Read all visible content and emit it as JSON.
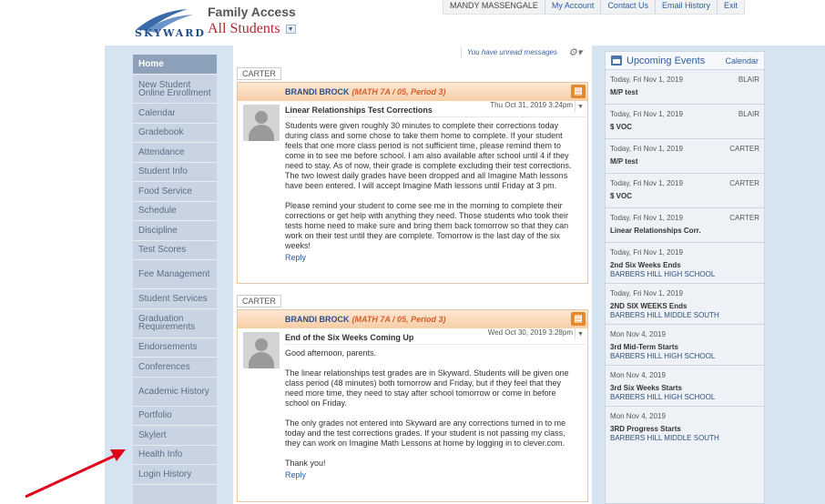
{
  "header": {
    "logo_text": "SKYWARD",
    "app_title": "Family Access",
    "student_selector": "All Students",
    "top_links": [
      "MANDY MASSENGALE",
      "My Account",
      "Contact Us",
      "Email History",
      "Exit"
    ]
  },
  "sidebar": {
    "items": [
      {
        "label": "Home",
        "active": true
      },
      {
        "label": "New Student Online Enrollment"
      },
      {
        "label": "Calendar"
      },
      {
        "label": "Gradebook"
      },
      {
        "label": "Attendance"
      },
      {
        "label": "Student Info"
      },
      {
        "label": "Food Service"
      },
      {
        "label": "Schedule"
      },
      {
        "label": "Discipline"
      },
      {
        "label": "Test Scores"
      },
      {
        "label": "Fee Management"
      },
      {
        "label": "Student Services"
      },
      {
        "label": "Graduation Requirements"
      },
      {
        "label": "Endorsements"
      },
      {
        "label": "Conferences"
      },
      {
        "label": "Academic History"
      },
      {
        "label": "Portfolio"
      },
      {
        "label": "Skylert"
      },
      {
        "label": "Health Info"
      },
      {
        "label": "Login History"
      }
    ]
  },
  "messages": {
    "unread_notice": "You have unread messages",
    "items": [
      {
        "student": "CARTER",
        "sender": "BRANDI BROCK",
        "class_info": "(MATH 7A / 05, Period 3)",
        "subject": "Linear Relationships Test Corrections",
        "timestamp": "Thu Oct 31, 2019 3:24pm",
        "paragraphs": [
          "Students were given roughly 30 minutes to complete their corrections today during class and some chose to take them home to complete.  If your student feels that one more class period is not sufficient time, please remind them to come in to see me before school.  I am also available after school until 4 if they need to stay.  As of now, their grade is complete excluding their test corrections.  The two lowest daily grades have been dropped and all Imagine Math lessons have been entered.  I will accept Imagine Math lessons until Friday at 3 pm.",
          "Please remind your student to come see me in the morning to complete their corrections or get help with anything they need.  Those students who took their tests home need to make sure and bring them back tomorrow so that they can work on their test until they are complete.  Tomorrow is the last day of the six weeks!"
        ],
        "reply_label": "Reply"
      },
      {
        "student": "CARTER",
        "sender": "BRANDI BROCK",
        "class_info": "(MATH 7A / 05, Period 3)",
        "subject": "End of the Six Weeks Coming Up",
        "timestamp": "Wed Oct 30, 2019 3:28pm",
        "paragraphs": [
          "Good afternoon, parents.",
          "The linear relationships test grades are in Skyward.  Students will be given one class period (48 minutes) both tomorrow and Friday, but if they feel that they need more time, they need to stay after school tomorrow or come in before school on Friday.",
          "The only grades not entered into Skyward are any corrections turned in to me today and the test corrections grades.  If your student is not passing my class, they can work on Imagine Math Lessons at home by logging in to clever.com.",
          "Thank you!"
        ],
        "reply_label": "Reply"
      }
    ]
  },
  "events": {
    "title": "Upcoming Events",
    "calendar_link": "Calendar",
    "items": [
      {
        "date": "Today, Fri Nov 1, 2019",
        "student": "BLAIR",
        "title": "M/P test",
        "school": ""
      },
      {
        "date": "Today, Fri Nov 1, 2019",
        "student": "BLAIR",
        "title": "$ VOC",
        "school": ""
      },
      {
        "date": "Today, Fri Nov 1, 2019",
        "student": "CARTER",
        "title": "M/P test",
        "school": ""
      },
      {
        "date": "Today, Fri Nov 1, 2019",
        "student": "CARTER",
        "title": "$ VOC",
        "school": ""
      },
      {
        "date": "Today, Fri Nov 1, 2019",
        "student": "CARTER",
        "title": "Linear Relationships Corr.",
        "school": ""
      },
      {
        "date": "Today, Fri Nov 1, 2019",
        "student": "",
        "title": "2nd Six Weeks Ends",
        "school": "BARBERS HILL HIGH SCHOOL"
      },
      {
        "date": "Today, Fri Nov 1, 2019",
        "student": "",
        "title": "2ND SIX WEEKS Ends",
        "school": "BARBERS HILL MIDDLE SOUTH"
      },
      {
        "date": "Mon Nov 4, 2019",
        "student": "",
        "title": "3rd Mid-Term Starts",
        "school": "BARBERS HILL HIGH SCHOOL"
      },
      {
        "date": "Mon Nov 4, 2019",
        "student": "",
        "title": "3rd Six Weeks Starts",
        "school": "BARBERS HILL HIGH SCHOOL"
      },
      {
        "date": "Mon Nov 4, 2019",
        "student": "",
        "title": "3RD Progress Starts",
        "school": "BARBERS HILL MIDDLE SOUTH"
      }
    ]
  },
  "colors": {
    "accent_red": "#b0262b",
    "link_blue": "#2d5d9b",
    "nav_bg": "#c8d4e2",
    "card_header": "#f8cda5",
    "annotation_arrow": "#e0001b"
  }
}
